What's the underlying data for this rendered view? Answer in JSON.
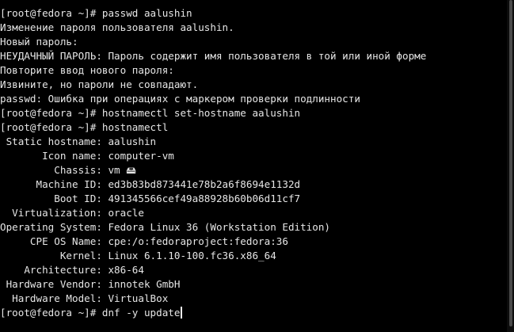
{
  "terminal": {
    "lines": [
      "[root@fedora ~]# passwd aalushin",
      "Изменение пароля пользователя aalushin.",
      "Новый пароль:",
      "НЕУДАЧНЫЙ ПАРОЛЬ: Пароль содержит имя пользователя в той или иной форме",
      "Повторите ввод нового пароля:",
      "Извините, но пароли не совпадают.",
      "passwd: Ошибка при операциях с маркером проверки подлинности",
      "[root@fedora ~]# hostnamectl set-hostname aalushin",
      "[root@fedora ~]# hostnamectl",
      " Static hostname: aalushin",
      "       Icon name: computer-vm",
      "         Chassis: vm 🖴",
      "      Machine ID: ed3b83bd873441e78b2a6f8694e1132d",
      "         Boot ID: 491345566cef49a88928b60b06d11cf7",
      "  Virtualization: oracle",
      "Operating System: Fedora Linux 36 (Workstation Edition)",
      "     CPE OS Name: cpe:/o:fedoraproject:fedora:36",
      "          Kernel: Linux 6.1.10-100.fc36.x86_64",
      "    Architecture: x86-64",
      " Hardware Vendor: innotek GmbH",
      "  Hardware Model: VirtualBox"
    ],
    "prompt_line": "[root@fedora ~]# dnf -y update"
  },
  "colors": {
    "background": "#000000",
    "foreground": "#e6e6e6",
    "scrollbar": "#4a4a4a"
  }
}
